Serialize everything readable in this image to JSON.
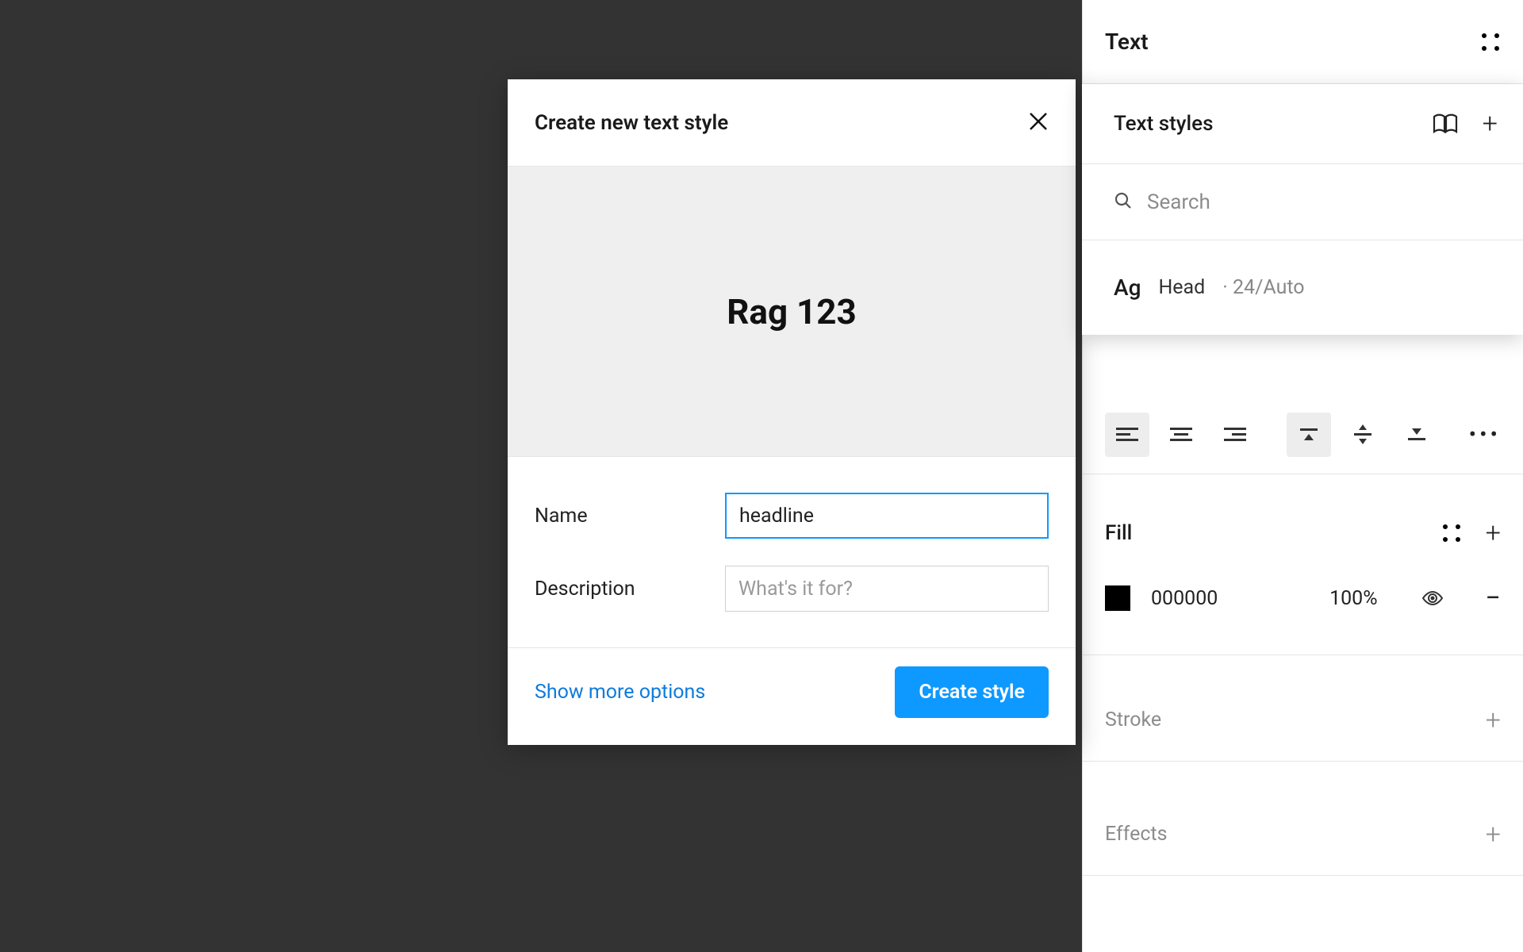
{
  "modal": {
    "title": "Create new text style",
    "preview_text": "Rag 123",
    "name_label": "Name",
    "name_value": "headline",
    "description_label": "Description",
    "description_placeholder": "What's it for?",
    "show_more_label": "Show more options",
    "submit_label": "Create style"
  },
  "panel": {
    "title": "Text",
    "styles": {
      "heading": "Text styles",
      "search_placeholder": "Search",
      "item": {
        "sample": "Ag",
        "name": "Head",
        "meta": "· 24/Auto"
      }
    },
    "fill": {
      "label": "Fill",
      "hex": "000000",
      "opacity": "100%"
    },
    "stroke_label": "Stroke",
    "effects_label": "Effects"
  }
}
